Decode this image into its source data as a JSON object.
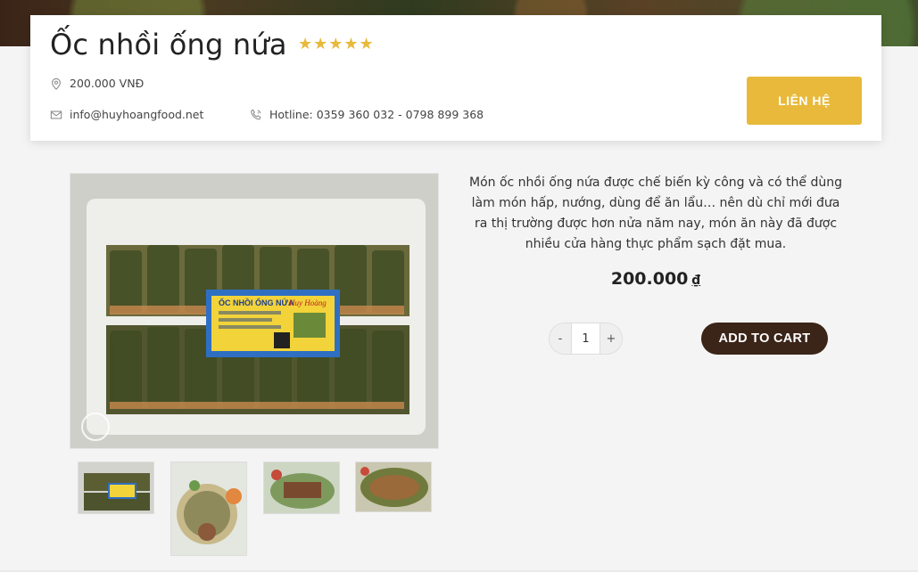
{
  "product": {
    "title": "Ốc nhồi ống nứa",
    "rating_stars": "★★★★★",
    "price_line": "200.000 VNĐ",
    "email": "info@huyhoangfood.net",
    "hotline": "Hotline: 0359 360 032 - 0798 899 368",
    "contact_label": "LIÊN HỆ",
    "description": "Món ốc nhồi ống nứa được chế biến kỳ công và có thể dùng làm món hấp, nướng, dùng để ăn lẩu… nên dù chỉ mới đưa ra thị trường được hơn nửa năm nay, món ăn này đã được nhiều cửa hàng thực phẩm sạch đặt mua.",
    "price_value": "200.000",
    "currency": "₫"
  },
  "cart": {
    "minus": "-",
    "quantity": "1",
    "plus": "+",
    "add_label": "ADD TO CART"
  },
  "image": {
    "package_brand": "Huy Hoàng",
    "package_label": "ỐC NHỒI ỐNG NỨA"
  },
  "colors": {
    "accent": "#e8b93a",
    "button_dark": "#3b2418"
  }
}
